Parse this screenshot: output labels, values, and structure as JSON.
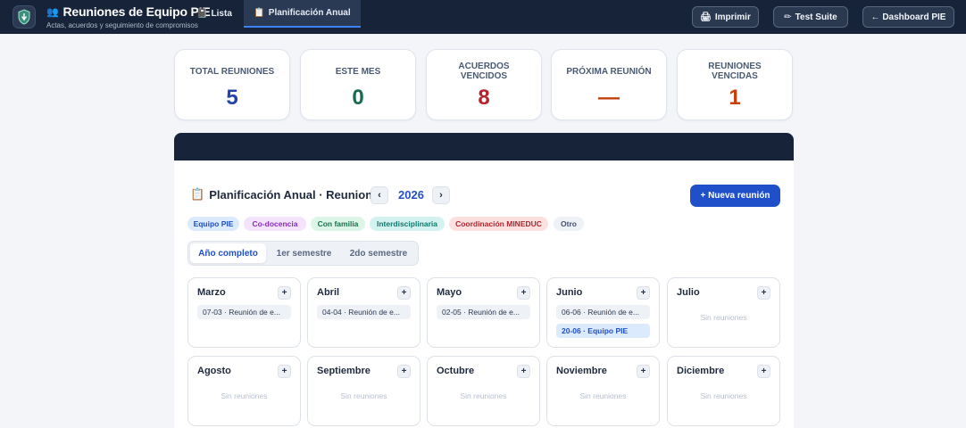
{
  "header": {
    "logo_icon": "shield-icon",
    "title": "Reuniones de Equipo PIE",
    "subtitle": "Actas, acuerdos y seguimiento de compromisos",
    "buttons": {
      "print": "Imprimir",
      "test": "Test Suite",
      "dashboard": "← Dashboard PIE"
    }
  },
  "stats": [
    {
      "label": "TOTAL REUNIONES",
      "value": "5",
      "color": "#2445a8"
    },
    {
      "label": "ESTE MES",
      "value": "0",
      "color": "#166a4e"
    },
    {
      "label": "ACUERDOS VENCIDOS",
      "value": "8",
      "color": "#b4232c"
    },
    {
      "label": "PRÓXIMA REUNIÓN",
      "value": "—",
      "color": "#c2410c"
    },
    {
      "label": "REUNIONES VENCIDAS",
      "value": "1",
      "color": "#c2410c"
    }
  ],
  "tabs": [
    {
      "label": "Lista",
      "icon": "notebook-icon"
    },
    {
      "label": "Planificación Anual",
      "icon": "clipboard-icon"
    }
  ],
  "planner": {
    "title": "Planificación Anual · Reuniones",
    "prev": "‹",
    "next": "›",
    "year": "2026",
    "new_button": "+ Nueva reunión"
  },
  "legend": [
    {
      "label": "Equipo PIE",
      "bg": "#dceafe",
      "fg": "#1f4fc9"
    },
    {
      "label": "Co-docencia",
      "bg": "#f3e3fb",
      "fg": "#8a2fb5"
    },
    {
      "label": "Con familia",
      "bg": "#dcf5e6",
      "fg": "#17734a"
    },
    {
      "label": "Interdisciplinaria",
      "bg": "#d4f3f0",
      "fg": "#11766b"
    },
    {
      "label": "Coordinación MINEDUC",
      "bg": "#fde1e1",
      "fg": "#b4232c"
    },
    {
      "label": "Otro",
      "bg": "#eef1f6",
      "fg": "#44506a"
    }
  ],
  "segments": [
    "Año completo",
    "1er semestre",
    "2do semestre"
  ],
  "months": [
    {
      "name": "Marzo",
      "events": [
        "07-03 · Reunión de e..."
      ]
    },
    {
      "name": "Abril",
      "events": [
        "04-04 · Reunión de e..."
      ]
    },
    {
      "name": "Mayo",
      "events": [
        "02-05 · Reunión de e..."
      ]
    },
    {
      "name": "Junio",
      "events": [
        "06-06 · Reunión de e...",
        "20-06 · Equipo PIE"
      ]
    },
    {
      "name": "Julio",
      "events": [],
      "empty": "Sin reuniones"
    },
    {
      "name": "Agosto",
      "events": [],
      "empty": "Sin reuniones"
    },
    {
      "name": "Septiembre",
      "events": [],
      "empty": "Sin reuniones"
    },
    {
      "name": "Octubre",
      "events": [],
      "empty": "Sin reuniones"
    },
    {
      "name": "Noviembre",
      "events": [],
      "empty": "Sin reuniones"
    },
    {
      "name": "Diciembre",
      "events": [],
      "empty": "Sin reuniones"
    }
  ],
  "add_label": "+"
}
